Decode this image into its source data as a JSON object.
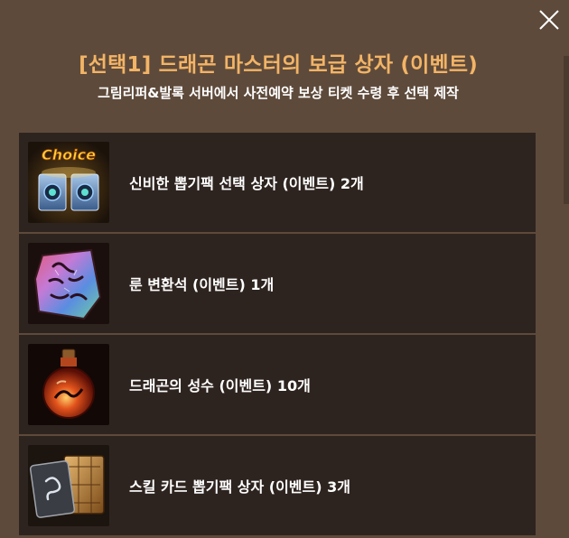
{
  "header": {
    "title": "[선택1] 드래곤 마스터의 보급 상자 (이벤트)",
    "subtitle": "그림리퍼&발록 서버에서 사전예약 보상 티켓 수령 후 선택 제작"
  },
  "items": [
    {
      "label": "신비한 뽑기팩 선택 상자 (이벤트) 2개",
      "icon": "choice-box-icon",
      "icon_text": "Choice"
    },
    {
      "label": "룬 변환석 (이벤트) 1개",
      "icon": "rune-stone-icon"
    },
    {
      "label": "드래곤의 성수 (이벤트) 10개",
      "icon": "holy-water-flask-icon"
    },
    {
      "label": "스킬 카드 뽑기팩 상자 (이벤트) 3개",
      "icon": "skill-card-box-icon"
    }
  ],
  "colors": {
    "background": "#5e4a3b",
    "row_background": "#2e241f",
    "title": "#f2b466",
    "text": "#ffffff"
  }
}
